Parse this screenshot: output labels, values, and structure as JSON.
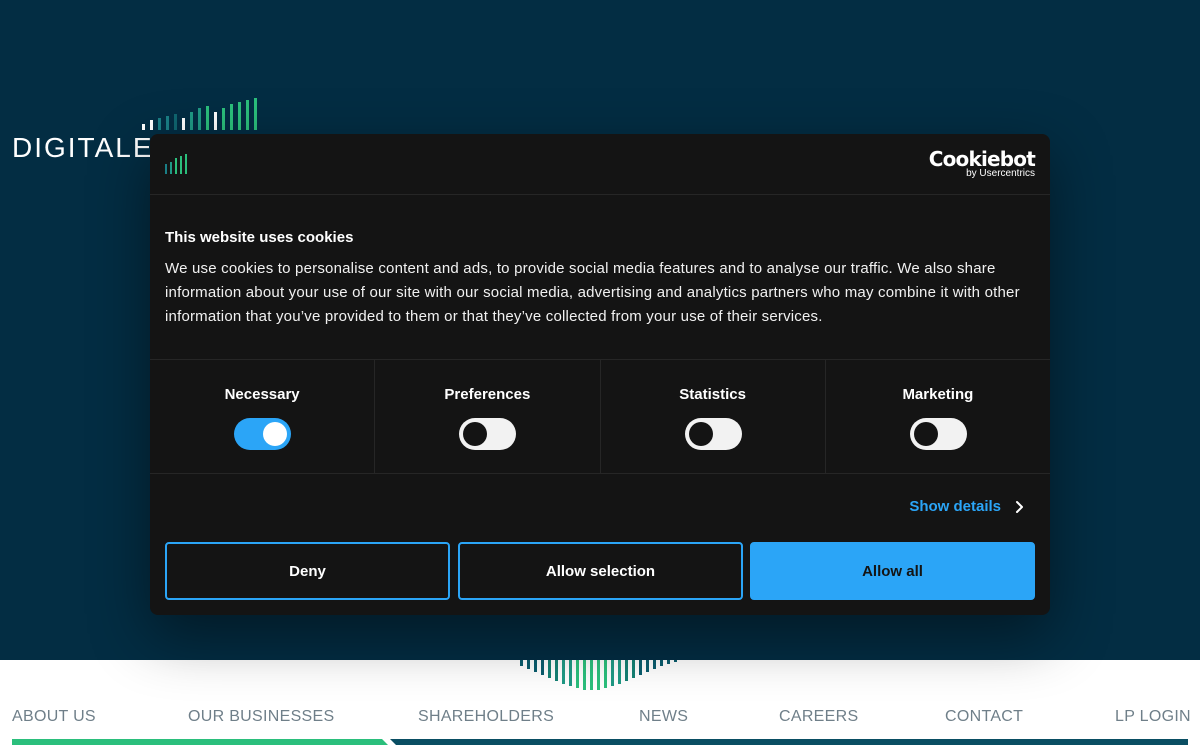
{
  "site": {
    "brand_text": "DIGITALE",
    "nav": [
      {
        "label": "ABOUT US"
      },
      {
        "label": "OUR BUSINESSES"
      },
      {
        "label": "SHAREHOLDERS"
      },
      {
        "label": "NEWS"
      },
      {
        "label": "CAREERS"
      },
      {
        "label": "CONTACT"
      },
      {
        "label": "LP LOGIN"
      }
    ],
    "colors": {
      "hero_bg": "#032d43",
      "brand_green": "#2bbf7c",
      "brand_teal": "#0a5d6e"
    }
  },
  "cookie_dialog": {
    "provider_name": "Cookiebot",
    "provider_by": "by Usercentrics",
    "title": "This website uses cookies",
    "body": "We use cookies to personalise content and ads, to provide social media features and to analyse our traffic. We also share information about your use of our site with our social media, advertising and analytics partners who may combine it with other information that you’ve provided to them or that they’ve collected from your use of their services.",
    "categories": [
      {
        "label": "Necessary",
        "enabled": true
      },
      {
        "label": "Preferences",
        "enabled": false
      },
      {
        "label": "Statistics",
        "enabled": false
      },
      {
        "label": "Marketing",
        "enabled": false
      }
    ],
    "show_details": "Show details",
    "buttons": {
      "deny": "Deny",
      "allow_selection": "Allow selection",
      "allow_all": "Allow all"
    },
    "colors": {
      "accent": "#2ba5f7",
      "background": "#141414"
    },
    "icons": {
      "show_details": "chevron-right-icon",
      "logo": "bars-logo-icon"
    }
  }
}
